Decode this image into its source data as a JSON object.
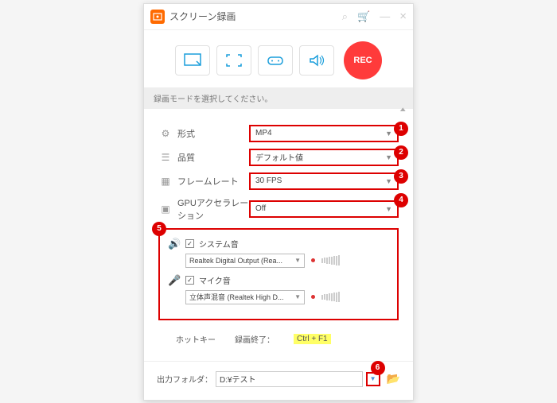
{
  "titlebar": {
    "title": "スクリーン録画"
  },
  "toolbar": {
    "rec": "REC"
  },
  "hint": "録画モードを選択してください。",
  "settings": {
    "format": {
      "label": "形式",
      "value": "MP4"
    },
    "quality": {
      "label": "品質",
      "value": "デフォルト値"
    },
    "framerate": {
      "label": "フレームレート",
      "value": "30 FPS"
    },
    "gpu": {
      "label": "GPUアクセラレーション",
      "value": "Off"
    }
  },
  "audio": {
    "system": {
      "label": "システム音",
      "device": "Realtek Digital Output (Rea..."
    },
    "mic": {
      "label": "マイク音",
      "device": "立体声混音 (Realtek High D..."
    }
  },
  "hotkey": {
    "label": "ホットキー",
    "action": "録画終了：",
    "value": "Ctrl + F1"
  },
  "output": {
    "label": "出力フォルダ：",
    "path": "D:¥テスト"
  },
  "badges": {
    "b1": "1",
    "b2": "2",
    "b3": "3",
    "b4": "4",
    "b5": "5",
    "b6": "6"
  }
}
